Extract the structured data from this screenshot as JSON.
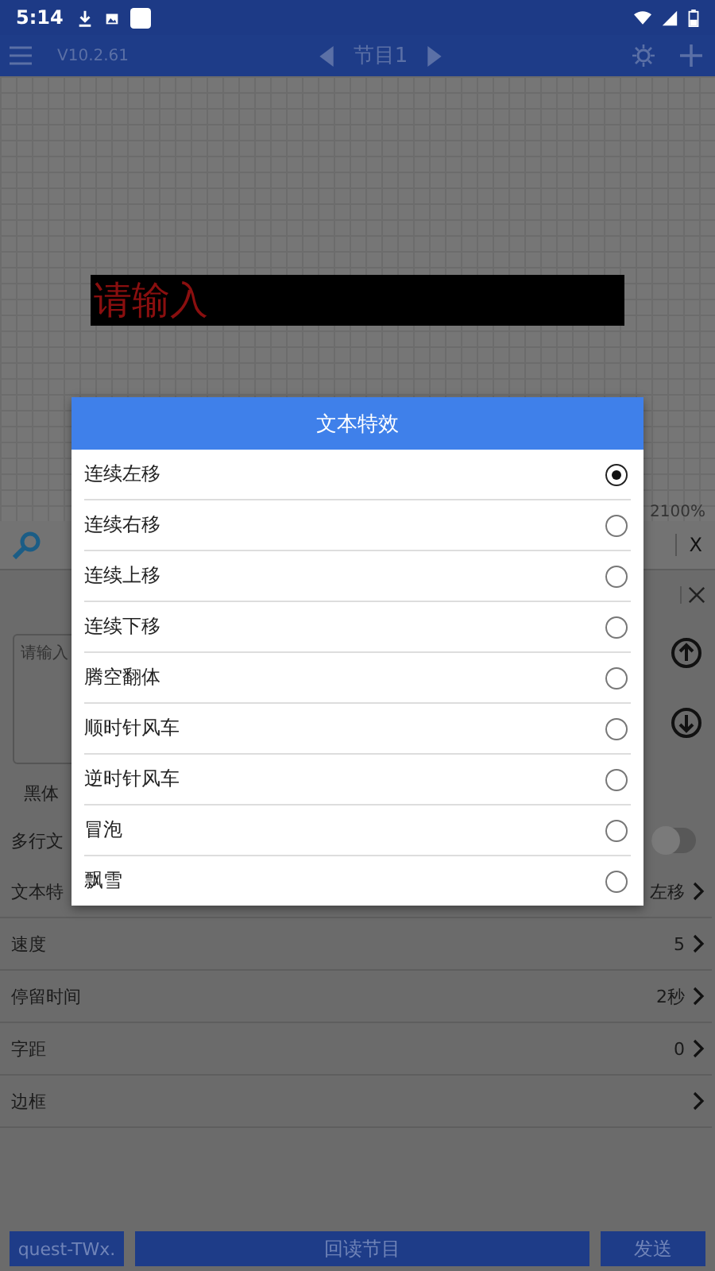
{
  "status_bar": {
    "time": "5:14"
  },
  "app_bar": {
    "version": "V10.2.61",
    "program": "节目1"
  },
  "canvas": {
    "text": "请输入",
    "zoom": "2100%"
  },
  "toolbar": {
    "close_label": "X"
  },
  "editor": {
    "placeholder": "请输入",
    "font": "黑体",
    "multiline_label": "多行文",
    "multiline_on": false
  },
  "settings": [
    {
      "label": "文本特",
      "value": "左移"
    },
    {
      "label": "速度",
      "value": "5"
    },
    {
      "label": "停留时间",
      "value": "2秒"
    },
    {
      "label": "字距",
      "value": "0"
    },
    {
      "label": "边框"
    }
  ],
  "bottom_buttons": [
    "quest-TWx.",
    "回读节目",
    "发送"
  ],
  "dialog": {
    "title": "文本特效",
    "options": [
      {
        "label": "连续左移",
        "selected": true
      },
      {
        "label": "连续右移",
        "selected": false
      },
      {
        "label": "连续上移",
        "selected": false
      },
      {
        "label": "连续下移",
        "selected": false
      },
      {
        "label": "腾空翻体",
        "selected": false
      },
      {
        "label": "顺时针风车",
        "selected": false
      },
      {
        "label": "逆时针风车",
        "selected": false
      },
      {
        "label": "冒泡",
        "selected": false
      },
      {
        "label": "飘雪",
        "selected": false
      }
    ]
  }
}
